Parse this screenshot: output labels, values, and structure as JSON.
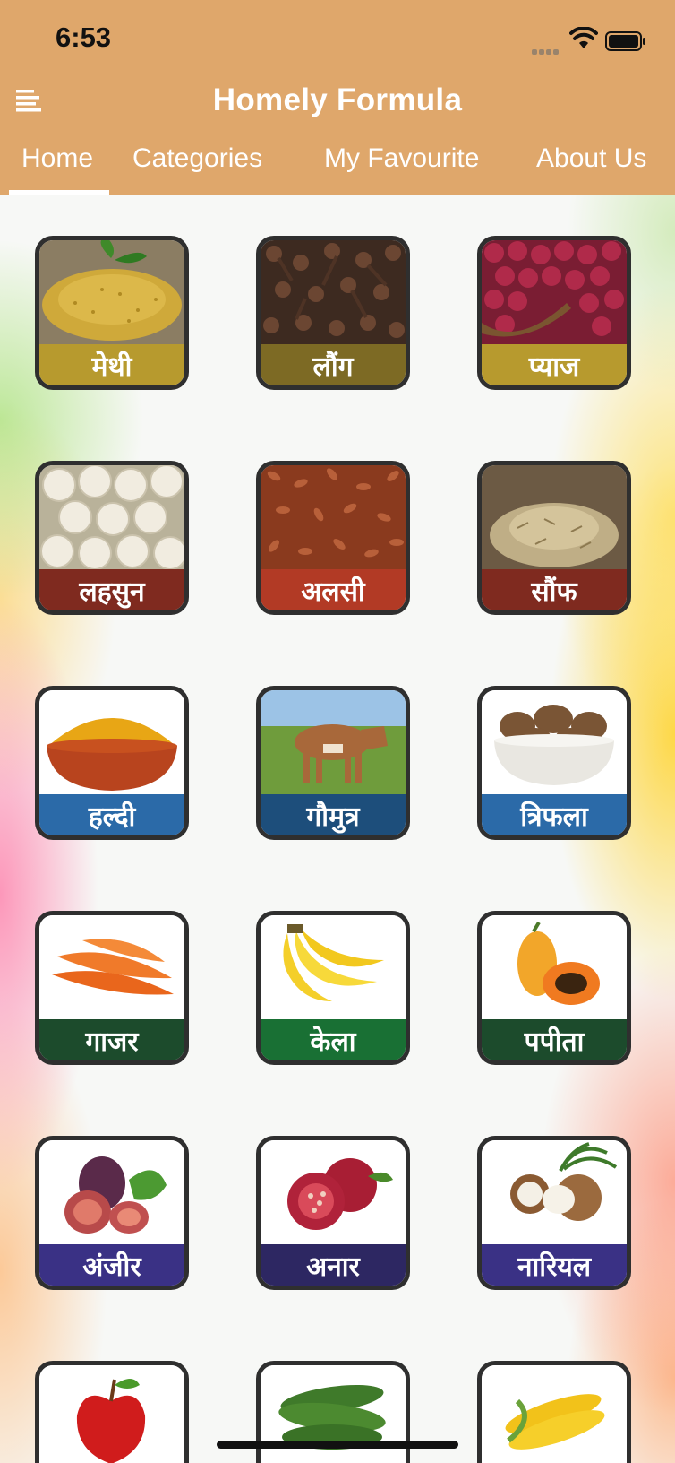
{
  "status_bar": {
    "time": "6:53"
  },
  "header": {
    "title": "Homely Formula",
    "menu_icon": "menu-icon",
    "tabs": [
      {
        "label": "Home",
        "active": true
      },
      {
        "label": "Categories",
        "active": false
      },
      {
        "label": "My Favourite",
        "active": false
      },
      {
        "label": "About Us",
        "active": false
      }
    ]
  },
  "colors": {
    "header_bg": "#dfa76b",
    "tile_border": "#2f2f2f",
    "band_olive": "#a98f2b",
    "band_maroon": "#8b2a1e",
    "band_blue": "#2c6aa6",
    "band_green": "#1b5b34",
    "band_indigo": "#3a2f78"
  },
  "grid": {
    "items": [
      {
        "label": "मेथी",
        "image": "fenugreek-seeds",
        "band": "#b79a2e"
      },
      {
        "label": "लौंग",
        "image": "cloves",
        "band": "#7d6a24"
      },
      {
        "label": "प्याज",
        "image": "onions",
        "band": "#b79a2e"
      },
      {
        "label": "लहसुन",
        "image": "garlic",
        "band": "#7f2a1f"
      },
      {
        "label": "अलसी",
        "image": "flax-seeds",
        "band": "#b23a25"
      },
      {
        "label": "सौंफ",
        "image": "fennel-seeds",
        "band": "#7f2a1f"
      },
      {
        "label": "हल्दी",
        "image": "turmeric",
        "band": "#2b6aa8"
      },
      {
        "label": "गौमुत्र",
        "image": "cow",
        "band": "#1d4e7b"
      },
      {
        "label": "त्रिफला",
        "image": "triphala",
        "band": "#2b6aa8"
      },
      {
        "label": "गाजर",
        "image": "carrots",
        "band": "#1c4b2c"
      },
      {
        "label": "केला",
        "image": "bananas",
        "band": "#197034"
      },
      {
        "label": "पपीता",
        "image": "papaya",
        "band": "#1c4b2c"
      },
      {
        "label": "अंजीर",
        "image": "figs",
        "band": "#3a3185"
      },
      {
        "label": "अनार",
        "image": "pomegranate",
        "band": "#2d2762"
      },
      {
        "label": "नारियल",
        "image": "coconut",
        "band": "#3a3185"
      },
      {
        "label": "",
        "image": "apple",
        "band": "#ffffff"
      },
      {
        "label": "",
        "image": "bitter-gourd",
        "band": "#ffffff"
      },
      {
        "label": "",
        "image": "corn",
        "band": "#ffffff"
      }
    ]
  }
}
